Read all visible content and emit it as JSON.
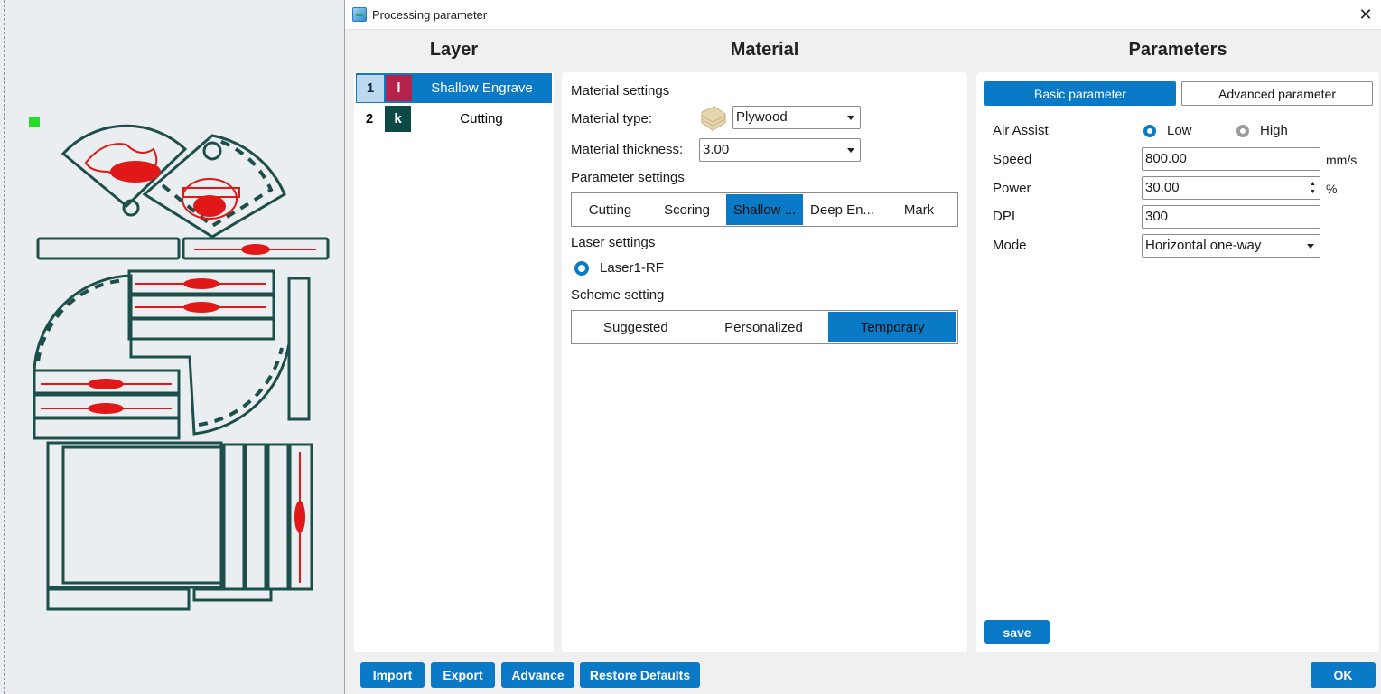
{
  "window": {
    "title": "Processing parameter",
    "close_glyph": "✕"
  },
  "headers": {
    "layer": "Layer",
    "material": "Material",
    "parameters": "Parameters"
  },
  "layers": [
    {
      "num": "1",
      "swatch_letter": "l",
      "swatch_color": "#b5234a",
      "name": "Shallow Engrave",
      "selected": true
    },
    {
      "num": "2",
      "swatch_letter": "k",
      "swatch_color": "#0d4a45",
      "name": "Cutting",
      "selected": false
    }
  ],
  "material": {
    "settings_title": "Material settings",
    "type_label": "Material type:",
    "type_value": "Plywood",
    "type_icon": "plywood-icon",
    "thickness_label": "Material thickness:",
    "thickness_value": "3.00",
    "param_settings_title": "Parameter settings",
    "param_tabs": [
      "Cutting",
      "Scoring",
      "Shallow ...",
      "Deep En...",
      "Mark"
    ],
    "param_tab_active": 2,
    "laser_title": "Laser settings",
    "laser_option": "Laser1-RF",
    "scheme_title": "Scheme setting",
    "scheme_tabs": [
      "Suggested",
      "Personalized",
      "Temporary"
    ],
    "scheme_tab_active": 2
  },
  "parameters": {
    "tab_basic": "Basic parameter",
    "tab_advanced": "Advanced parameter",
    "air_assist_label": "Air Assist",
    "air_low": "Low",
    "air_high": "High",
    "air_selected": "Low",
    "speed_label": "Speed",
    "speed_value": "800.00",
    "speed_unit": "mm/s",
    "power_label": "Power",
    "power_value": "30.00",
    "power_unit": "%",
    "dpi_label": "DPI",
    "dpi_value": "300",
    "mode_label": "Mode",
    "mode_value": "Horizontal one-way",
    "save_label": "save"
  },
  "footer": {
    "import": "Import",
    "export": "Export",
    "advance": "Advance",
    "restore": "Restore Defaults",
    "ok": "OK"
  },
  "colors": {
    "accent": "#0a79c6",
    "cut_stroke": "#1d4f4a",
    "engrave_stroke": "#e01818",
    "marker": "#22dd22"
  }
}
